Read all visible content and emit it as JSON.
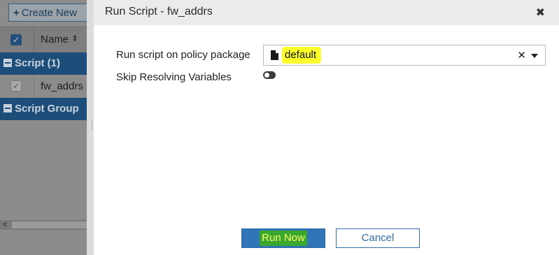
{
  "background": {
    "toolbar": {
      "create_new_label": "Create New"
    },
    "table": {
      "header_name": "Name",
      "groups": [
        {
          "label": "Script (1)"
        },
        {
          "label": "Script Group"
        }
      ],
      "rows": [
        {
          "name": "fw_addrs"
        }
      ]
    }
  },
  "dialog": {
    "title": "Run Script - fw_addrs",
    "fields": {
      "policy_package_label": "Run script on policy package",
      "policy_package_value": "default",
      "skip_resolving_label": "Skip Resolving Variables",
      "skip_resolving_on": false
    },
    "buttons": {
      "run_now": "Run Now",
      "cancel": "Cancel"
    }
  },
  "colors": {
    "accent": "#2f75b8",
    "group_row": "#1d4e7a",
    "highlight_yellow": "#ffff2a",
    "highlight_green": "#3aa72f"
  }
}
